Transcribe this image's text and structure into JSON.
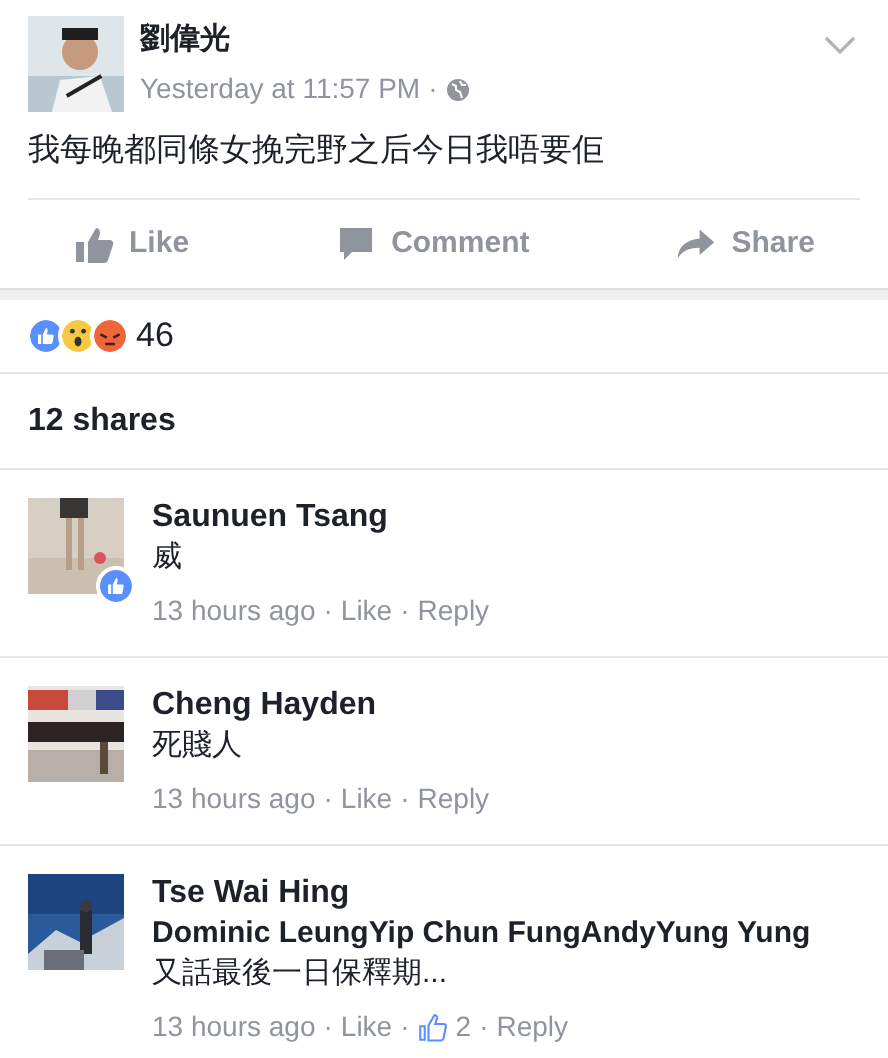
{
  "post": {
    "author": "劉偉光",
    "time": "Yesterday at 11:57 PM",
    "separator": "·",
    "text": "我每晚都同條女挽完野之后今日我唔要佢"
  },
  "actions": [
    {
      "kind": "like",
      "label": "Like"
    },
    {
      "kind": "comment",
      "label": "Comment"
    },
    {
      "kind": "share",
      "label": "Share"
    }
  ],
  "reactions": {
    "icons": [
      {
        "kind": "like"
      },
      {
        "kind": "wow"
      },
      {
        "kind": "angry"
      }
    ],
    "count": "46"
  },
  "shares": "12 shares",
  "comments": [
    {
      "name": "Saunuen Tsang",
      "text": "威",
      "liked": true,
      "time": "13 hours ago",
      "like": "Like",
      "reply": "Reply",
      "sep": "·"
    },
    {
      "name": "Cheng Hayden",
      "text": "死賤人",
      "liked": false,
      "time": "13 hours ago",
      "like": "Like",
      "reply": "Reply",
      "sep": "·"
    },
    {
      "name": "Tse Wai Hing",
      "text": "**Dominic LeungYip Chun FungAndyYung Yung**又話最後一日保釋期...",
      "liked": false,
      "time": "13 hours ago",
      "like": "Like",
      "likes": "2",
      "reply": "Reply",
      "sep": "·"
    }
  ]
}
